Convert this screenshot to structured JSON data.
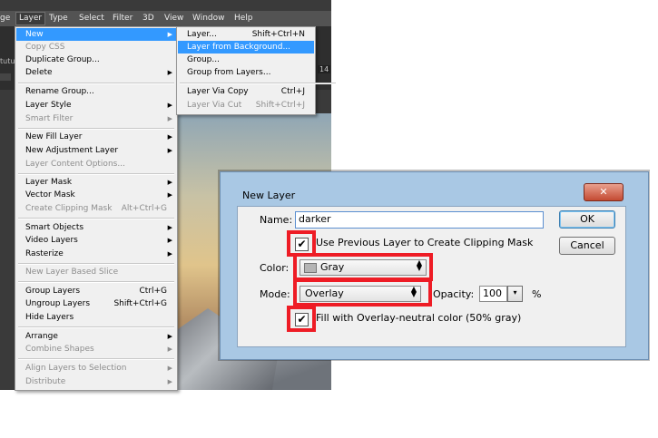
{
  "menubar": [
    "ge",
    "Layer",
    "Type",
    "Select",
    "Filter",
    "3D",
    "View",
    "Window",
    "Help"
  ],
  "options_bar": {
    "left_label": "tutuls",
    "right_value": "14"
  },
  "layer_menu": {
    "items": [
      {
        "label": "New",
        "shortcut": "",
        "arrow": "▶"
      },
      {
        "label": "Copy CSS",
        "shortcut": "",
        "arrow": ""
      },
      {
        "label": "Duplicate Group...",
        "shortcut": "",
        "arrow": ""
      },
      {
        "label": "Delete",
        "shortcut": "",
        "arrow": "▶"
      },
      {
        "label": "Rename Group...",
        "shortcut": "",
        "arrow": ""
      },
      {
        "label": "Layer Style",
        "shortcut": "",
        "arrow": "▶"
      },
      {
        "label": "Smart Filter",
        "shortcut": "",
        "arrow": "▶"
      },
      {
        "label": "New Fill Layer",
        "shortcut": "",
        "arrow": "▶"
      },
      {
        "label": "New Adjustment Layer",
        "shortcut": "",
        "arrow": "▶"
      },
      {
        "label": "Layer Content Options...",
        "shortcut": "",
        "arrow": ""
      },
      {
        "label": "Layer Mask",
        "shortcut": "",
        "arrow": "▶"
      },
      {
        "label": "Vector Mask",
        "shortcut": "",
        "arrow": "▶"
      },
      {
        "label": "Create Clipping Mask",
        "shortcut": "Alt+Ctrl+G",
        "arrow": ""
      },
      {
        "label": "Smart Objects",
        "shortcut": "",
        "arrow": "▶"
      },
      {
        "label": "Video Layers",
        "shortcut": "",
        "arrow": "▶"
      },
      {
        "label": "Rasterize",
        "shortcut": "",
        "arrow": "▶"
      },
      {
        "label": "New Layer Based Slice",
        "shortcut": "",
        "arrow": ""
      },
      {
        "label": "Group Layers",
        "shortcut": "Ctrl+G",
        "arrow": ""
      },
      {
        "label": "Ungroup Layers",
        "shortcut": "Shift+Ctrl+G",
        "arrow": ""
      },
      {
        "label": "Hide Layers",
        "shortcut": "",
        "arrow": ""
      },
      {
        "label": "Arrange",
        "shortcut": "",
        "arrow": "▶"
      },
      {
        "label": "Combine Shapes",
        "shortcut": "",
        "arrow": "▶"
      },
      {
        "label": "Align Layers to Selection",
        "shortcut": "",
        "arrow": "▶"
      },
      {
        "label": "Distribute",
        "shortcut": "",
        "arrow": "▶"
      }
    ]
  },
  "new_submenu": {
    "items": [
      {
        "label": "Layer...",
        "shortcut": "Shift+Ctrl+N"
      },
      {
        "label": "Layer from Background...",
        "shortcut": ""
      },
      {
        "label": "Group...",
        "shortcut": ""
      },
      {
        "label": "Group from Layers...",
        "shortcut": ""
      },
      {
        "label": "Layer Via Copy",
        "shortcut": "Ctrl+J"
      },
      {
        "label": "Layer Via Cut",
        "shortcut": "Shift+Ctrl+J"
      }
    ]
  },
  "dialog": {
    "title": "New Layer",
    "close_glyph": "✕",
    "name_label": "Name:",
    "name_value": "darker",
    "clip_label": "Use Previous Layer to Create Clipping Mask",
    "clip_checked": "✔",
    "color_label": "Color:",
    "color_value": "Gray",
    "mode_label": "Mode:",
    "mode_value": "Overlay",
    "opacity_label": "Opacity:",
    "opacity_value": "100",
    "opacity_unit": "%",
    "fill_label": "Fill with Overlay-neutral color (50% gray)",
    "fill_checked": "✔",
    "ok_label": "OK",
    "cancel_label": "Cancel",
    "highlight_color": "#ee1c25"
  }
}
